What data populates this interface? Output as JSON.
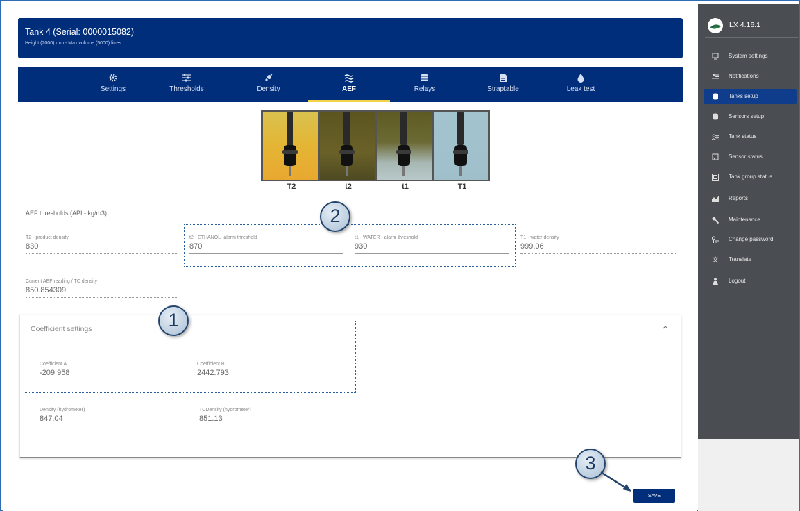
{
  "tank": {
    "title": "Tank 4 (Serial: 0000015082)",
    "subtitle": "Height (2000) mm - Max volume (5000) litres"
  },
  "tabs": [
    {
      "label": "Settings",
      "icon": "gear-icon"
    },
    {
      "label": "Thresholds",
      "icon": "sliders-icon"
    },
    {
      "label": "Density",
      "icon": "drops-icon"
    },
    {
      "label": "AEF",
      "icon": "waves-icon",
      "active": true
    },
    {
      "label": "Relays",
      "icon": "relays-icon"
    },
    {
      "label": "Straptable",
      "icon": "document-icon"
    },
    {
      "label": "Leak test",
      "icon": "drop-icon"
    }
  ],
  "sensor": {
    "labels": [
      "T2",
      "t2",
      "t1",
      "T1"
    ],
    "panel_colors": [
      "#e4b534",
      "#6a6128",
      "#8e946a",
      "#a3c4cf"
    ]
  },
  "aef": {
    "heading": "AEF thresholds (API - kg/m3)",
    "t2_product_label": "T2 - product density",
    "t2_product_value": "830",
    "t2_ethanol_label": "t2 - ETHANOL- alarm threshold",
    "t2_ethanol_value": "870",
    "t1_water_label": "t1 - WATER - alarm threshold",
    "t1_water_value": "930",
    "T1_water_label": "T1 - water density",
    "T1_water_value": "999.06",
    "current_label": "Current AEF reading / TC density",
    "current_value": "850.854309"
  },
  "coefficients": {
    "title": "Coefficient settings",
    "a_label": "Coefficient A",
    "a_value": "-209.958",
    "b_label": "Coefficient B",
    "b_value": "2442.793",
    "density_label": "Density (hydrometer)",
    "density_value": "847.04",
    "tcdensity_label": "TCDensity (hydrometer)",
    "tcdensity_value": "851.13"
  },
  "callouts": [
    "1",
    "2",
    "3"
  ],
  "save_label": "SAVE",
  "sidebar": {
    "version": "LX 4.16.1",
    "items": [
      {
        "label": "System settings",
        "icon": "monitor-icon"
      },
      {
        "label": "Notifications",
        "icon": "notifications-icon"
      },
      {
        "label": "Tanks setup",
        "icon": "database-icon",
        "active": true
      },
      {
        "label": "Sensors setup",
        "icon": "database-icon"
      },
      {
        "label": "Tank status",
        "icon": "waves-icon"
      },
      {
        "label": "Sensor status",
        "icon": "cast-icon"
      },
      {
        "label": "Tank group status",
        "icon": "group-icon"
      },
      {
        "label": "Reports",
        "icon": "chart-icon"
      },
      {
        "label": "Maintenance",
        "icon": "wrench-icon"
      },
      {
        "label": "Change password",
        "icon": "key-icon"
      },
      {
        "label": "Translate",
        "icon": "translate-icon"
      },
      {
        "label": "Logout",
        "icon": "logout-icon"
      }
    ]
  },
  "colors": {
    "primary": "#002e7a",
    "accent": "#f1d34b",
    "sidebar": "#4a4d52",
    "sidebar_active": "#0f3d8c",
    "callout_border": "#23446d",
    "dotted_box": "#2b5f9c"
  }
}
